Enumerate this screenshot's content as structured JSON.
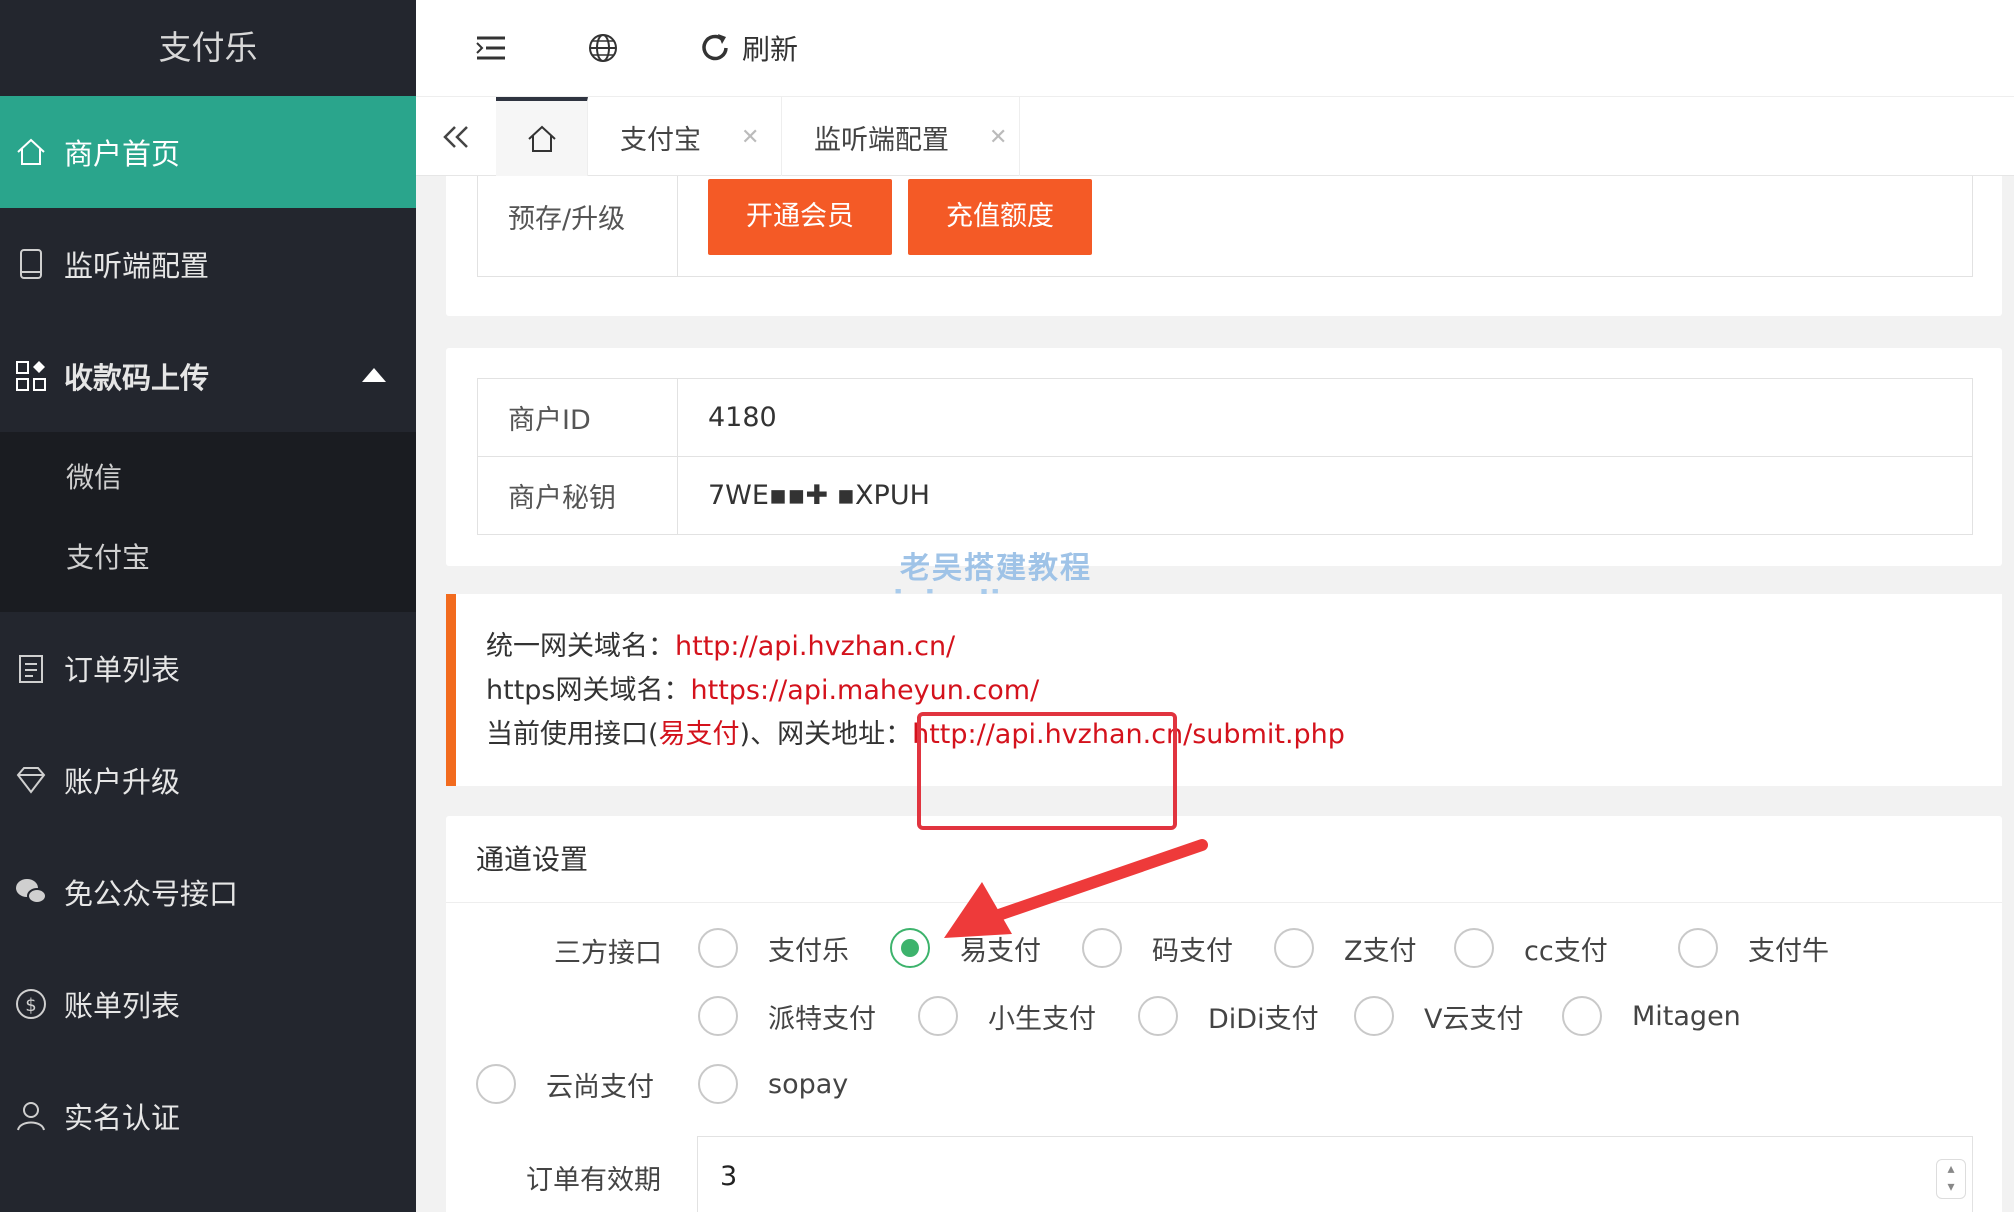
{
  "sidebar": {
    "brand": "支付乐",
    "items": [
      {
        "label": "商户首页",
        "icon": "home-icon"
      },
      {
        "label": "监听端配置",
        "icon": "tablet-icon"
      },
      {
        "label": "收款码上传",
        "icon": "qrcode-icon"
      },
      {
        "label": "订单列表",
        "icon": "clipboard-icon"
      },
      {
        "label": "账户升级",
        "icon": "diamond-icon"
      },
      {
        "label": "免公众号接口",
        "icon": "wechat-icon"
      },
      {
        "label": "账单列表",
        "icon": "dollar-icon"
      },
      {
        "label": "实名认证",
        "icon": "user-icon"
      }
    ],
    "submenu": [
      "微信",
      "支付宝"
    ]
  },
  "topbar": {
    "refresh_label": "刷新"
  },
  "tabs": [
    {
      "label": "支付宝"
    },
    {
      "label": "监听端配置"
    }
  ],
  "upgrade": {
    "label": "预存/升级",
    "btn_member": "开通会员",
    "btn_recharge": "充值额度"
  },
  "merchant": {
    "id_label": "商户ID",
    "id_value": "4180",
    "key_label": "商户秘钥",
    "key_value": "7WE▪▪✚ ▪XPUH"
  },
  "watermark": {
    "line1": "老吴搭建教程",
    "line2": "weixiaolive.com"
  },
  "notice": {
    "gw_label": "统一网关域名：",
    "gw_value": "http://api.hvzhan.cn/",
    "https_label": "https网关域名：",
    "https_value": "https://api.maheyun.com/",
    "cur_prefix": "当前使用接口(",
    "cur_iface": "易支付",
    "cur_mid": ")、网关地址：",
    "cur_value": "http://api.hvzhan.cn/submit.php"
  },
  "channel": {
    "title": "通道设置",
    "field_label": "三方接口",
    "options": [
      "支付乐",
      "易支付",
      "码支付",
      "Z支付",
      "cc支付",
      "支付牛",
      "派特支付",
      "小生支付",
      "DiDi支付",
      "V云支付",
      "Mitagen",
      "云尚支付",
      "sopay"
    ],
    "selected": "易支付",
    "expire_label": "订单有效期",
    "expire_value": "3"
  },
  "colors": {
    "sidebar_bg": "#23262e",
    "active_green": "#2aa58c",
    "orange": "#f45a26",
    "red_link": "#d4121c"
  }
}
